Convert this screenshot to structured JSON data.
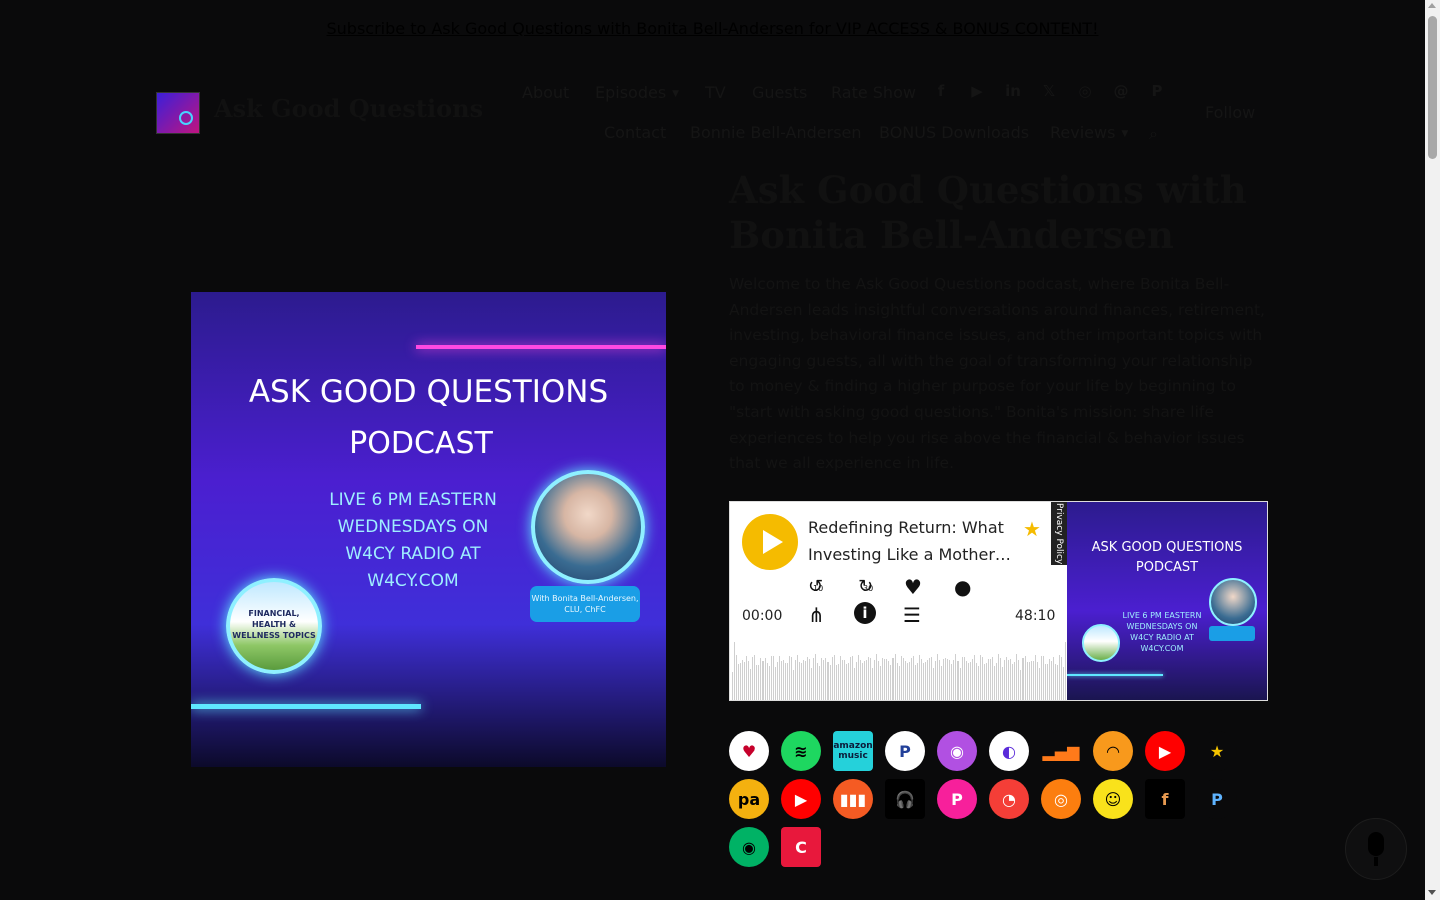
{
  "banner": {
    "link_text": "Subscribe to Ask Good Questions with Bonita Bell-Andersen for VIP ACCESS & BONUS CONTENT!"
  },
  "site": {
    "title": "Ask Good Questions"
  },
  "nav": {
    "row1": [
      "About",
      "Episodes",
      "TV",
      "Guests",
      "Rate Show"
    ],
    "row2": [
      "Contact",
      "Bonnie Bell-Andersen",
      "BONUS Downloads",
      "Reviews"
    ],
    "follow": "Follow"
  },
  "social": [
    {
      "name": "facebook-icon",
      "glyph": "f"
    },
    {
      "name": "youtube-icon",
      "glyph": "▶"
    },
    {
      "name": "linkedin-icon",
      "glyph": "in"
    },
    {
      "name": "x-icon",
      "glyph": "𝕏"
    },
    {
      "name": "instagram-icon",
      "glyph": "◎"
    },
    {
      "name": "threads-icon",
      "glyph": "@"
    },
    {
      "name": "pinterest-icon",
      "glyph": "P"
    }
  ],
  "cover": {
    "line1": "ASK GOOD QUESTIONS",
    "line2": "PODCAST",
    "sub": "LIVE 6 PM EASTERN WEDNESDAYS ON W4CY RADIO AT W4CY.COM",
    "badge": "With Bonita Bell-Andersen, CLU, ChFC",
    "topics": "FINANCIAL, HEALTH & WELLNESS TOPICS"
  },
  "main": {
    "heading": "Ask Good Questions with Bonita Bell-Andersen",
    "description": "Welcome to the Ask Good Questions podcast, where Bonita Bell-Andersen leads insightful conversations around finances, retirement, investing, behavioral finance issues, and other important topics with engaging guests, all with the goal of transforming your relationship to money & finding a higher purpose for your life by beginning to \"start with asking good questions.\" Bonita's mission: share life experiences to help you rise above the financial & behavior issues that we all experience in life."
  },
  "player": {
    "episode_title": "Redefining Return: What Investing Like a Mother…",
    "privacy": "Privacy Policy",
    "current_time": "00:00",
    "duration": "48:10",
    "rewind_label": "10",
    "forward_label": "30",
    "thumb_title": "ASK GOOD QUESTIONS PODCAST",
    "thumb_sub": "LIVE 6 PM EASTERN WEDNESDAYS ON W4CY RADIO AT W4CY.COM"
  },
  "platforms": [
    {
      "name": "iheart-icon",
      "glyph": "♥",
      "bg": "#ffffff",
      "fg": "#c6002b"
    },
    {
      "name": "spotify-icon",
      "glyph": "≋",
      "bg": "#1ed760",
      "fg": "#000000"
    },
    {
      "name": "amazon-music-icon",
      "glyph": "amazon music",
      "bg": "#25d1da",
      "fg": "#0b1b3a"
    },
    {
      "name": "pandora-icon",
      "glyph": "P",
      "bg": "#ffffff",
      "fg": "#224099"
    },
    {
      "name": "apple-podcasts-icon",
      "glyph": "◉",
      "bg": "#b150e2",
      "fg": "#ffffff"
    },
    {
      "name": "podcast-addict-icon",
      "glyph": "◐",
      "bg": "#ffffff",
      "fg": "#5a2bd9"
    },
    {
      "name": "deezer-icon",
      "glyph": "▂▄▆",
      "bg": "#0a0a0b",
      "fg": "#ff7a1a"
    },
    {
      "name": "audible-icon",
      "glyph": "◠",
      "bg": "#f8991c",
      "fg": "#000000"
    },
    {
      "name": "youtube-music-icon",
      "glyph": "▶",
      "bg": "#ff0000",
      "fg": "#ffffff"
    },
    {
      "name": "podchaser-star-icon",
      "glyph": "★",
      "bg": "#0a0a0b",
      "fg": "#f5c400"
    },
    {
      "name": "podcast-index-icon",
      "glyph": "pa",
      "bg": "#f4b10f",
      "fg": "#000000"
    },
    {
      "name": "youtube-icon",
      "glyph": "▶",
      "bg": "#ff0000",
      "fg": "#ffffff"
    },
    {
      "name": "castbox-icon",
      "glyph": "▮▮▮",
      "bg": "#f55b23",
      "fg": "#ffffff"
    },
    {
      "name": "podcast-guru-icon",
      "glyph": "🎧",
      "bg": "#000000",
      "fg": "#1ea7ff"
    },
    {
      "name": "podbean-icon",
      "glyph": "P",
      "bg": "#f7209b",
      "fg": "#ffffff"
    },
    {
      "name": "pocket-casts-icon",
      "glyph": "◔",
      "bg": "#f43e37",
      "fg": "#ffffff"
    },
    {
      "name": "overcast-icon",
      "glyph": "◎",
      "bg": "#fc7e0f",
      "fg": "#ffffff"
    },
    {
      "name": "listen-notes-icon",
      "glyph": "☺",
      "bg": "#f9e21b",
      "fg": "#000000"
    },
    {
      "name": "fountain-icon",
      "glyph": "f",
      "bg": "#000000",
      "fg": "#e79a51"
    },
    {
      "name": "podverse-icon",
      "glyph": "P",
      "bg": "#0a0a0b",
      "fg": "#5fb4ff"
    },
    {
      "name": "castro-icon",
      "glyph": "◉",
      "bg": "#00b265",
      "fg": "#000000"
    },
    {
      "name": "curiocaster-icon",
      "glyph": "C",
      "bg": "#e8183c",
      "fg": "#ffffff"
    }
  ]
}
